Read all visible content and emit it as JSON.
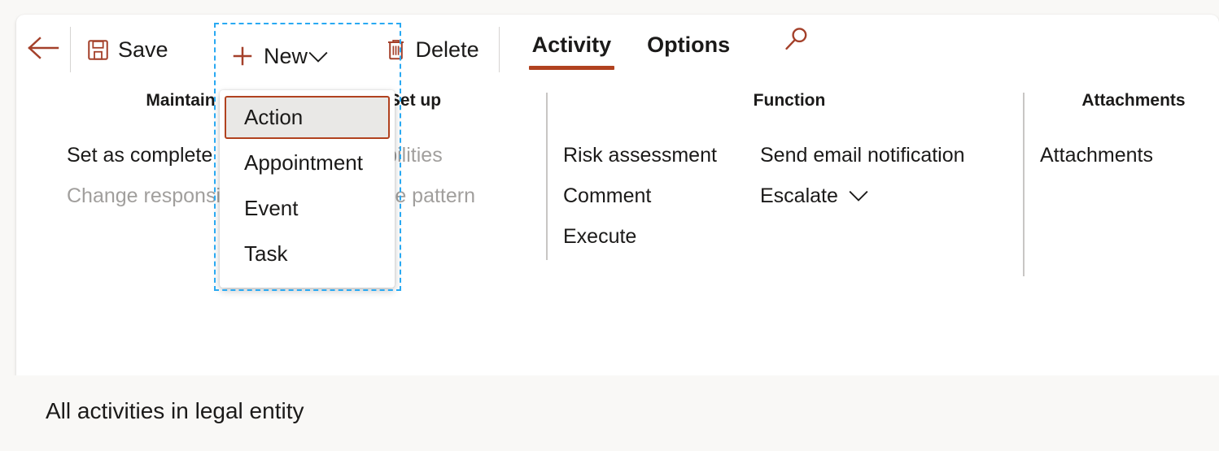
{
  "colors": {
    "accent": "#b1421f",
    "icon": "#a4402a",
    "selection": "#29a9f2",
    "text": "#1b1a19",
    "disabled_text": "#a19f9d",
    "divider": "#c8c6c4",
    "panel_bg": "#ffffff",
    "page_bg": "#f9f8f6",
    "selected_item_bg": "#e9e8e6"
  },
  "command_bar": {
    "back_icon": "arrow-left-icon",
    "save": {
      "label": "Save",
      "icon": "save-icon"
    },
    "new": {
      "label": "New",
      "icon": "plus-icon",
      "caret": "chevron-down-icon",
      "selected": true
    },
    "delete": {
      "label": "Delete",
      "icon": "trash-icon"
    },
    "tabs": [
      {
        "label": "Activity",
        "active": true
      },
      {
        "label": "Options",
        "active": false
      }
    ],
    "search": {
      "icon": "search-icon"
    }
  },
  "new_menu": {
    "items": [
      {
        "label": "Action",
        "selected": true
      },
      {
        "label": "Appointment",
        "selected": false
      },
      {
        "label": "Event",
        "selected": false
      },
      {
        "label": "Task",
        "selected": false
      }
    ]
  },
  "groups": [
    {
      "title": "Maintain",
      "columns": [
        {
          "items": [
            {
              "label": "Set as complete",
              "disabled": false
            },
            {
              "label": "Change responsible",
              "disabled": true
            }
          ]
        }
      ]
    },
    {
      "title": "Set up",
      "columns": [
        {
          "items": [
            {
              "label": "Responsibilities",
              "disabled": true
            },
            {
              "label": "Recurrence pattern",
              "disabled": true
            }
          ]
        }
      ]
    },
    {
      "title": "Function",
      "columns": [
        {
          "items": [
            {
              "label": "Risk assessment",
              "disabled": false
            },
            {
              "label": "Comment",
              "disabled": false
            },
            {
              "label": "Execute",
              "disabled": false
            }
          ]
        },
        {
          "items": [
            {
              "label": "Send email notification",
              "disabled": false
            },
            {
              "label": "Escalate",
              "disabled": false,
              "caret": "chevron-down-icon"
            }
          ]
        }
      ]
    },
    {
      "title": "Attachments",
      "columns": [
        {
          "items": [
            {
              "label": "Attachments",
              "disabled": false
            }
          ]
        }
      ]
    }
  ],
  "footer": {
    "page_title": "All activities in legal entity"
  }
}
